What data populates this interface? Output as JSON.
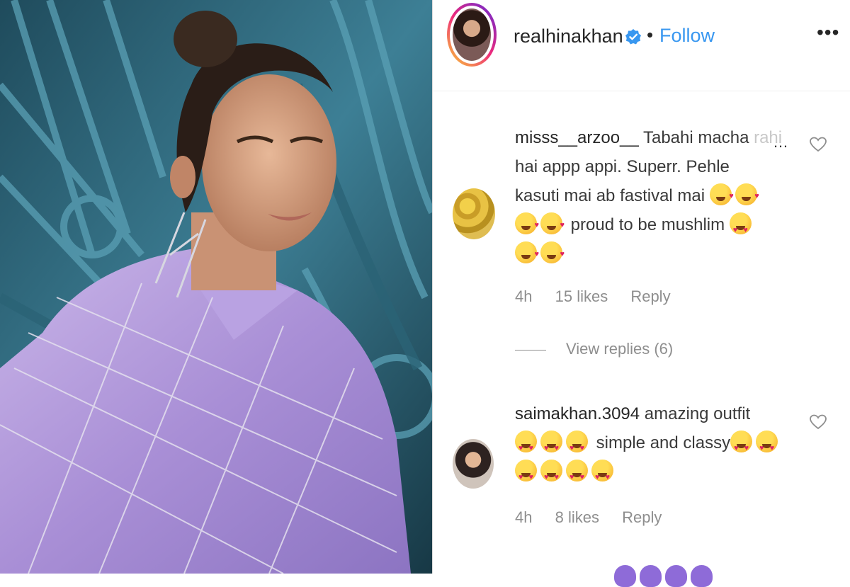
{
  "post": {
    "username": "realhinakhan",
    "separator": "•",
    "follow_label": "Follow",
    "more_label": "•••",
    "verified_icon": "verified-badge-icon",
    "accent_color": "#3897f0"
  },
  "comments": [
    {
      "username": "misss__arzoo__",
      "line1": "Tabahi macha ",
      "line1_faded": "rahi",
      "line2": "hai appp appi. Superr. Pehle",
      "line3": "kasuti mai ab fastival mai",
      "line4": "proud to be mushlim",
      "time": "4h",
      "likes": "15 likes",
      "reply_label": "Reply",
      "view_replies": "View replies (6)",
      "emojis": [
        "face-blowing-kiss",
        "face-blowing-kiss",
        "face-blowing-kiss",
        "face-blowing-kiss",
        "heart-eyes",
        "face-blowing-kiss",
        "face-blowing-kiss"
      ]
    },
    {
      "username": "saimakhan.3094",
      "line1": "amazing outfit",
      "line2": "simple and classy",
      "time": "4h",
      "likes": "8 likes",
      "reply_label": "Reply",
      "emojis": [
        "heart-eyes",
        "heart-eyes",
        "heart-eyes",
        "heart-eyes",
        "heart-eyes",
        "heart-eyes",
        "heart-eyes",
        "heart-eyes",
        "heart-eyes"
      ]
    }
  ]
}
